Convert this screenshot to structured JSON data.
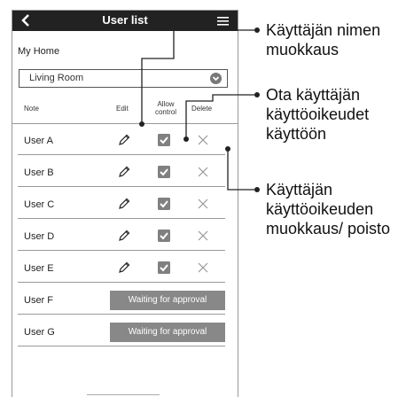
{
  "header": {
    "title": "User list"
  },
  "home": {
    "label": "My Home"
  },
  "room": {
    "selected": "Living Room"
  },
  "columns": {
    "note": "Note",
    "edit": "Edit",
    "allow": "Allow control",
    "delete": "Delete"
  },
  "users": [
    {
      "name": "User A",
      "state": "approved"
    },
    {
      "name": "User B",
      "state": "approved"
    },
    {
      "name": "User C",
      "state": "approved"
    },
    {
      "name": "User D",
      "state": "approved"
    },
    {
      "name": "User E",
      "state": "approved"
    },
    {
      "name": "User F",
      "state": "pending"
    },
    {
      "name": "User G",
      "state": "pending"
    }
  ],
  "pending_label": "Waiting for approval",
  "annotations": {
    "edit_name": "Käyttäjän nimen muokkaus",
    "enable_rights": "Ota käyttäjän käyttöoikeudet käyttöön",
    "edit_delete_rights": "Käyttäjän käyttöoikeuden muokkaus/ poisto"
  },
  "colors": {
    "titlebar": "#222222",
    "pending_button": "#888888",
    "checkbox": "#808080"
  },
  "icons": {
    "back": "chevron-left-icon",
    "menu": "hamburger-menu-icon",
    "select": "chevron-down-circle-icon",
    "edit": "pencil-icon",
    "allow": "checkbox-checked-icon",
    "delete": "close-x-icon"
  }
}
